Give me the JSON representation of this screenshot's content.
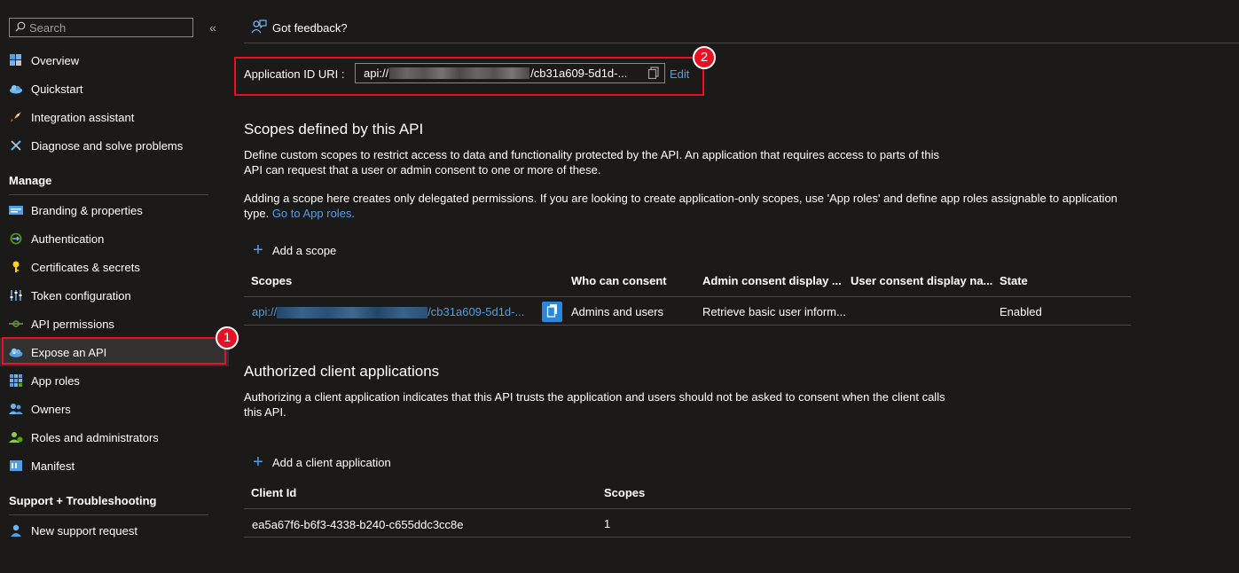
{
  "sidebar": {
    "search_placeholder": "Search",
    "collapse_glyph": "«",
    "top_items": [
      {
        "label": "Overview",
        "icon": "overview-icon"
      },
      {
        "label": "Quickstart",
        "icon": "quickstart-cloud-icon"
      },
      {
        "label": "Integration assistant",
        "icon": "rocket-icon"
      },
      {
        "label": "Diagnose and solve problems",
        "icon": "wrench-icon"
      }
    ],
    "manage_header": "Manage",
    "manage_items": [
      {
        "label": "Branding & properties",
        "icon": "branding-icon"
      },
      {
        "label": "Authentication",
        "icon": "authentication-icon"
      },
      {
        "label": "Certificates & secrets",
        "icon": "key-icon"
      },
      {
        "label": "Token configuration",
        "icon": "token-config-icon"
      },
      {
        "label": "API permissions",
        "icon": "api-permissions-icon"
      },
      {
        "label": "Expose an API",
        "icon": "expose-api-cloud-icon"
      },
      {
        "label": "App roles",
        "icon": "app-roles-icon"
      },
      {
        "label": "Owners",
        "icon": "owners-icon"
      },
      {
        "label": "Roles and administrators",
        "icon": "roles-admins-icon"
      },
      {
        "label": "Manifest",
        "icon": "manifest-icon"
      }
    ],
    "support_header": "Support + Troubleshooting",
    "support_items": [
      {
        "label": "New support request",
        "icon": "support-person-icon"
      }
    ]
  },
  "badges": {
    "one": "1",
    "two": "2"
  },
  "header": {
    "feedback_label": "Got feedback?"
  },
  "app_id": {
    "label": "Application ID URI :",
    "value_prefix": "api://",
    "value_suffix": "/cb31a609-5d1d-...",
    "edit_label": "Edit"
  },
  "scopes_section": {
    "title": "Scopes defined by this API",
    "desc1_line1": "Define custom scopes to restrict access to data and functionality protected by the API. An application that requires access to parts of this",
    "desc1_line2": "API can request that a user or admin consent to one or more of these.",
    "desc2_line1": "Adding a scope here creates only delegated permissions. If you are looking to create application-only scopes, use 'App roles' and define app roles assignable to application",
    "desc2_line2_prefix": "type.",
    "desc2_link": "Go to App roles.",
    "add_label": "Add a scope",
    "columns": [
      "Scopes",
      "Who can consent",
      "Admin consent display ...",
      "User consent display na...",
      "State"
    ],
    "row": {
      "scope_prefix": "api://",
      "scope_suffix": "/cb31a609-5d1d-...",
      "who": "Admins and users",
      "admin_display": "Retrieve basic user inform...",
      "user_display": "",
      "state": "Enabled"
    }
  },
  "clients_section": {
    "title": "Authorized client applications",
    "desc_line1": "Authorizing a client application indicates that this API trusts the application and users should not be asked to consent when the client calls",
    "desc_line2": "this API.",
    "add_label": "Add a client application",
    "columns": [
      "Client Id",
      "Scopes"
    ],
    "row": {
      "client_id": "ea5a67f6-b6f3-4338-b240-c655ddc3cc8e",
      "scopes": "1"
    }
  },
  "colors": {
    "background": "#1b1a19",
    "link": "#4f9ee6",
    "highlight": "#e81123",
    "active_nav": "#323130"
  }
}
